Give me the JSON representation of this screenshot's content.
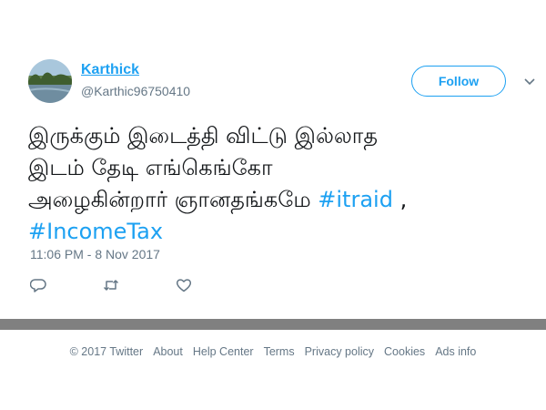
{
  "tweet": {
    "author": {
      "name": "Karthick",
      "handle": "@Karthic96750410"
    },
    "follow_label": "Follow",
    "text_lines": [
      "இருக்கும் இடைத்தி விட்டு இல்லாத",
      "இடம் தேடி எங்கெங்கோ",
      "அழைகின்றார் ஞானதங்கமே "
    ],
    "hashtags": [
      "#itraid",
      "#IncomeTax"
    ],
    "separator": " ,",
    "timestamp": "11:06 PM - 8 Nov 2017"
  },
  "icons": {
    "reply": "reply-icon",
    "retweet": "retweet-icon",
    "like": "heart-icon",
    "more": "chevron-down-icon"
  },
  "colors": {
    "accent": "#1da1f2",
    "secondary_text": "#657786",
    "divider": "#808080"
  },
  "footer": {
    "copyright": "© 2017 Twitter",
    "links": [
      "About",
      "Help Center",
      "Terms",
      "Privacy policy",
      "Cookies",
      "Ads info"
    ]
  }
}
